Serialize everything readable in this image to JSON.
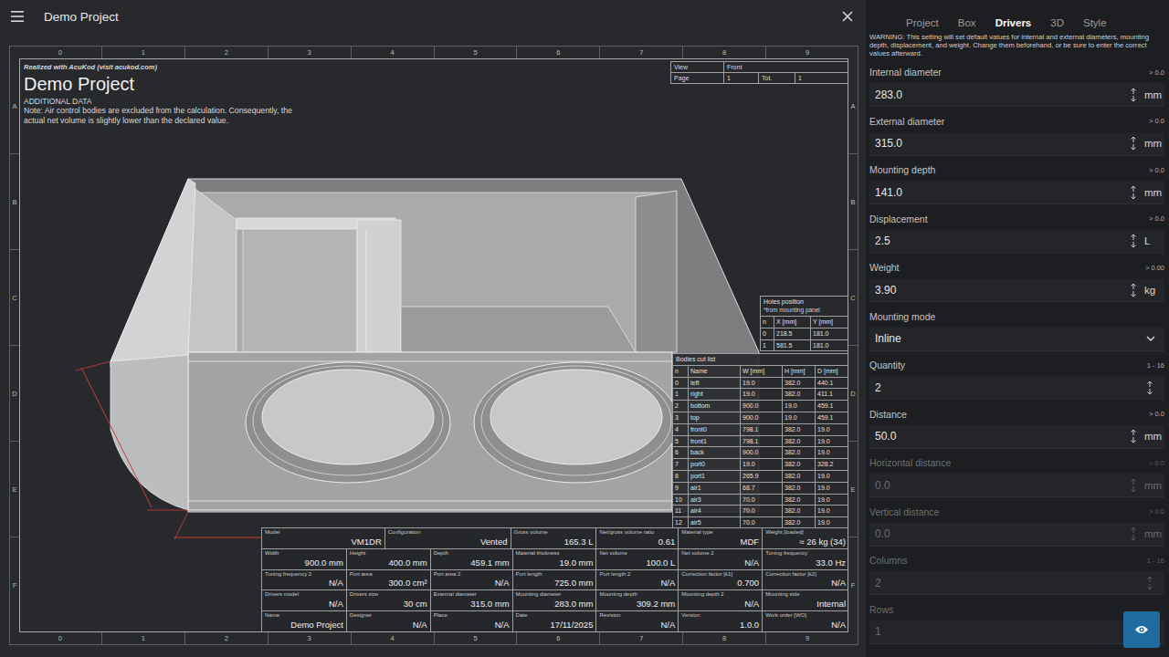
{
  "window": {
    "title": "Demo Project"
  },
  "sheet": {
    "ruler_columns": [
      "0",
      "1",
      "2",
      "3",
      "4",
      "5",
      "6",
      "7",
      "8",
      "9"
    ],
    "ruler_rows": [
      "A",
      "B",
      "C",
      "D",
      "E",
      "F"
    ],
    "credit": "Realized with AcuKod (visit acukod.com)",
    "title": "Demo Project",
    "subtitle": "ADDITIONAL DATA",
    "note": "Note: Air control bodies are excluded from the calculation. Consequently, the actual net volume is slightly lower than the declared value.",
    "view_table": {
      "view_label": "View",
      "view_value": "Front",
      "page_label": "Page",
      "page_value": "1",
      "total_label": "Tot.",
      "total_value": "1"
    },
    "holes": {
      "title": "Holes position",
      "subtitle": "*from mounting panel",
      "columns": [
        "n",
        "X [mm]",
        "Y [mm]"
      ],
      "rows": [
        [
          "0",
          "218.5",
          "181.0"
        ],
        [
          "1",
          "581.5",
          "181.0"
        ]
      ]
    },
    "bodies": {
      "title": "Bodies cut list",
      "columns": [
        "n",
        "Name",
        "W [mm]",
        "H [mm]",
        "D [mm]"
      ],
      "rows": [
        [
          "0",
          "left",
          "19.0",
          "382.0",
          "440.1"
        ],
        [
          "1",
          "right",
          "19.0",
          "382.0",
          "411.1"
        ],
        [
          "2",
          "bottom",
          "900.0",
          "19.0",
          "459.1"
        ],
        [
          "3",
          "top",
          "900.0",
          "19.0",
          "459.1"
        ],
        [
          "4",
          "front0",
          "798.1",
          "382.0",
          "19.0"
        ],
        [
          "5",
          "front1",
          "798.1",
          "382.0",
          "19.0"
        ],
        [
          "6",
          "back",
          "900.0",
          "382.0",
          "19.0"
        ],
        [
          "7",
          "port0",
          "19.0",
          "382.0",
          "328.2"
        ],
        [
          "8",
          "port1",
          "265.9",
          "382.0",
          "19.0"
        ],
        [
          "9",
          "air1",
          "68.7",
          "382.0",
          "19.0"
        ],
        [
          "10",
          "air3",
          "70.0",
          "382.0",
          "19.0"
        ],
        [
          "11",
          "air4",
          "70.0",
          "382.0",
          "19.0"
        ],
        [
          "12",
          "air5",
          "70.0",
          "382.0",
          "19.0"
        ]
      ]
    },
    "title_block": [
      [
        {
          "label": "Model",
          "value": "VM1DR"
        },
        {
          "label": "Configuration",
          "value": "Vented"
        },
        {
          "label": "Gross volume",
          "value": "165.3 L"
        },
        {
          "label": "Net/gross volume ratio",
          "value": "0.61"
        },
        {
          "label": "Material type",
          "value": "MDF"
        },
        {
          "label": "Weight [loaded]",
          "value": "≈ 26 kg (34)"
        }
      ],
      [
        {
          "label": "Width",
          "value": "900.0 mm"
        },
        {
          "label": "Height",
          "value": "400.0 mm"
        },
        {
          "label": "Depth",
          "value": "459.1 mm"
        },
        {
          "label": "Material thickness",
          "value": "19.0 mm"
        },
        {
          "label": "Net volume",
          "value": "100.0 L"
        },
        {
          "label": "Net volume 2",
          "value": "N/A"
        },
        {
          "label": "Tuning frequency",
          "value": "33.0 Hz"
        }
      ],
      [
        {
          "label": "Tuning frequency 2",
          "value": "N/A"
        },
        {
          "label": "Port area",
          "value": "300.0 cm²"
        },
        {
          "label": "Port area 2",
          "value": "N/A"
        },
        {
          "label": "Port length",
          "value": "725.0 mm"
        },
        {
          "label": "Port length 2",
          "value": "N/A"
        },
        {
          "label": "Correction factor [k1]",
          "value": "0.700"
        },
        {
          "label": "Correction factor [k2]",
          "value": "N/A"
        }
      ],
      [
        {
          "label": "Drivers model",
          "value": "N/A"
        },
        {
          "label": "Drivers size",
          "value": "30 cm"
        },
        {
          "label": "External diameter",
          "value": "315.0 mm"
        },
        {
          "label": "Mounting diameter",
          "value": "283.0 mm"
        },
        {
          "label": "Mounting depth",
          "value": "309.2 mm"
        },
        {
          "label": "Mounting depth 2",
          "value": "N/A"
        },
        {
          "label": "Mounting side",
          "value": "Internal"
        }
      ],
      [
        {
          "label": "Name",
          "value": "Demo Project"
        },
        {
          "label": "Designer",
          "value": "N/A"
        },
        {
          "label": "Place",
          "value": "N/A"
        },
        {
          "label": "Date",
          "value": "17/11/2025"
        },
        {
          "label": "Revision",
          "value": "N/A"
        },
        {
          "label": "Version",
          "value": "1.0.0"
        },
        {
          "label": "Work order [WO]",
          "value": "N/A"
        }
      ]
    ]
  },
  "panel": {
    "tabs": [
      {
        "label": "Project",
        "selected": false
      },
      {
        "label": "Box",
        "selected": false
      },
      {
        "label": "Drivers",
        "selected": true
      },
      {
        "label": "3D",
        "selected": false
      },
      {
        "label": "Style",
        "selected": false
      }
    ],
    "warning": "WARNING: This setting will set default values for internal and external diameters, mounting depth, displacement, and weight. Change them beforehand, or be sure to enter the correct values afterward.",
    "fields": [
      {
        "kind": "number",
        "label": "Internal diameter",
        "hint": "> 0.0",
        "value": "283.0",
        "unit": "mm",
        "disabled": false
      },
      {
        "kind": "number",
        "label": "External diameter",
        "hint": "> 0.0",
        "value": "315.0",
        "unit": "mm",
        "disabled": false
      },
      {
        "kind": "number",
        "label": "Mounting depth",
        "hint": "> 0.0",
        "value": "141.0",
        "unit": "mm",
        "disabled": false
      },
      {
        "kind": "number",
        "label": "Displacement",
        "hint": "> 0.0",
        "value": "2.5",
        "unit": "L",
        "disabled": false
      },
      {
        "kind": "number",
        "label": "Weight",
        "hint": "> 0.00",
        "value": "3.90",
        "unit": "kg",
        "disabled": false
      },
      {
        "kind": "select",
        "label": "Mounting mode",
        "value": "Inline",
        "disabled": false
      },
      {
        "kind": "number",
        "label": "Quantity",
        "hint": "1 - 16",
        "value": "2",
        "disabled": false
      },
      {
        "kind": "number",
        "label": "Distance",
        "hint": "> 0.0",
        "value": "50.0",
        "unit": "mm",
        "disabled": false
      },
      {
        "kind": "number",
        "label": "Horizontal distance",
        "hint": "> 0.0",
        "value": "0.0",
        "unit": "mm",
        "disabled": true
      },
      {
        "kind": "number",
        "label": "Vertical distance",
        "hint": "> 0.0",
        "value": "0.0",
        "unit": "mm",
        "disabled": true
      },
      {
        "kind": "number",
        "label": "Columns",
        "hint": "1 - 16",
        "value": "2",
        "disabled": true
      },
      {
        "kind": "number",
        "label": "Rows",
        "value": "1",
        "disabled": true
      }
    ]
  }
}
